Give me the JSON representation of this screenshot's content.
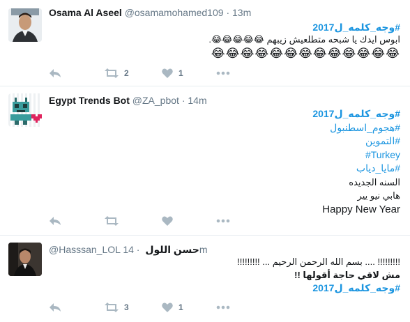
{
  "tweets": [
    {
      "name": "Osama Al Aseel",
      "handle": "@osamamohamed109",
      "time": "13m",
      "lines": [
        {
          "text": "#وجه_كلمه_ل2017",
          "kind": "hashtag"
        },
        {
          "text": "ابوس ايدك يا شبحه متطلعيش زيبهم 😂😂😂😂😂.",
          "kind": "text"
        },
        {
          "text": "😂😂😂😂😂😂😂😂😂😂😂😂😂",
          "kind": "emoji"
        }
      ],
      "retweets": "2",
      "likes": "1"
    },
    {
      "name": "Egypt Trends Bot",
      "handle": "@ZA_pbot",
      "time": "14m",
      "lines": [
        {
          "text": "#وجه_كلمه_ل2017",
          "kind": "hashtag"
        },
        {
          "text": "#هجوم_اسطنبول",
          "kind": "hashtag-light"
        },
        {
          "text": "#التموين",
          "kind": "hashtag-light"
        },
        {
          "text": "#Turkey",
          "kind": "hashtag-light"
        },
        {
          "text": "#مايا_دياب",
          "kind": "hashtag-light"
        },
        {
          "text": "السنه الجديده",
          "kind": "text"
        },
        {
          "text": "هابي نيو يير",
          "kind": "text"
        },
        {
          "text": "Happy New Year",
          "kind": "text-en"
        }
      ],
      "retweets": "",
      "likes": ""
    },
    {
      "name": "حسن اللول",
      "handle": "@Hasssan_LOL",
      "time": "14m",
      "lines": [
        {
          "text": "!!!!!!!!! .... بسم الله الرحمن الرحيم ... !!!!!!!!!",
          "kind": "text"
        },
        {
          "text": "مش لاقي حاجة أقولها !!",
          "kind": "text"
        },
        {
          "text": "#وجه_كلمه_ل2017",
          "kind": "hashtag"
        }
      ],
      "retweets": "3",
      "likes": "1"
    }
  ],
  "separator": "·",
  "colors": {
    "link": "#1b95e0",
    "muted": "#657786",
    "icon": "#aab8c2",
    "divider": "#e6ecf0",
    "heart": "#e0245e"
  },
  "icons": [
    "reply-icon",
    "retweet-icon",
    "like-icon",
    "more-icon",
    "bot-avatar-icon"
  ]
}
